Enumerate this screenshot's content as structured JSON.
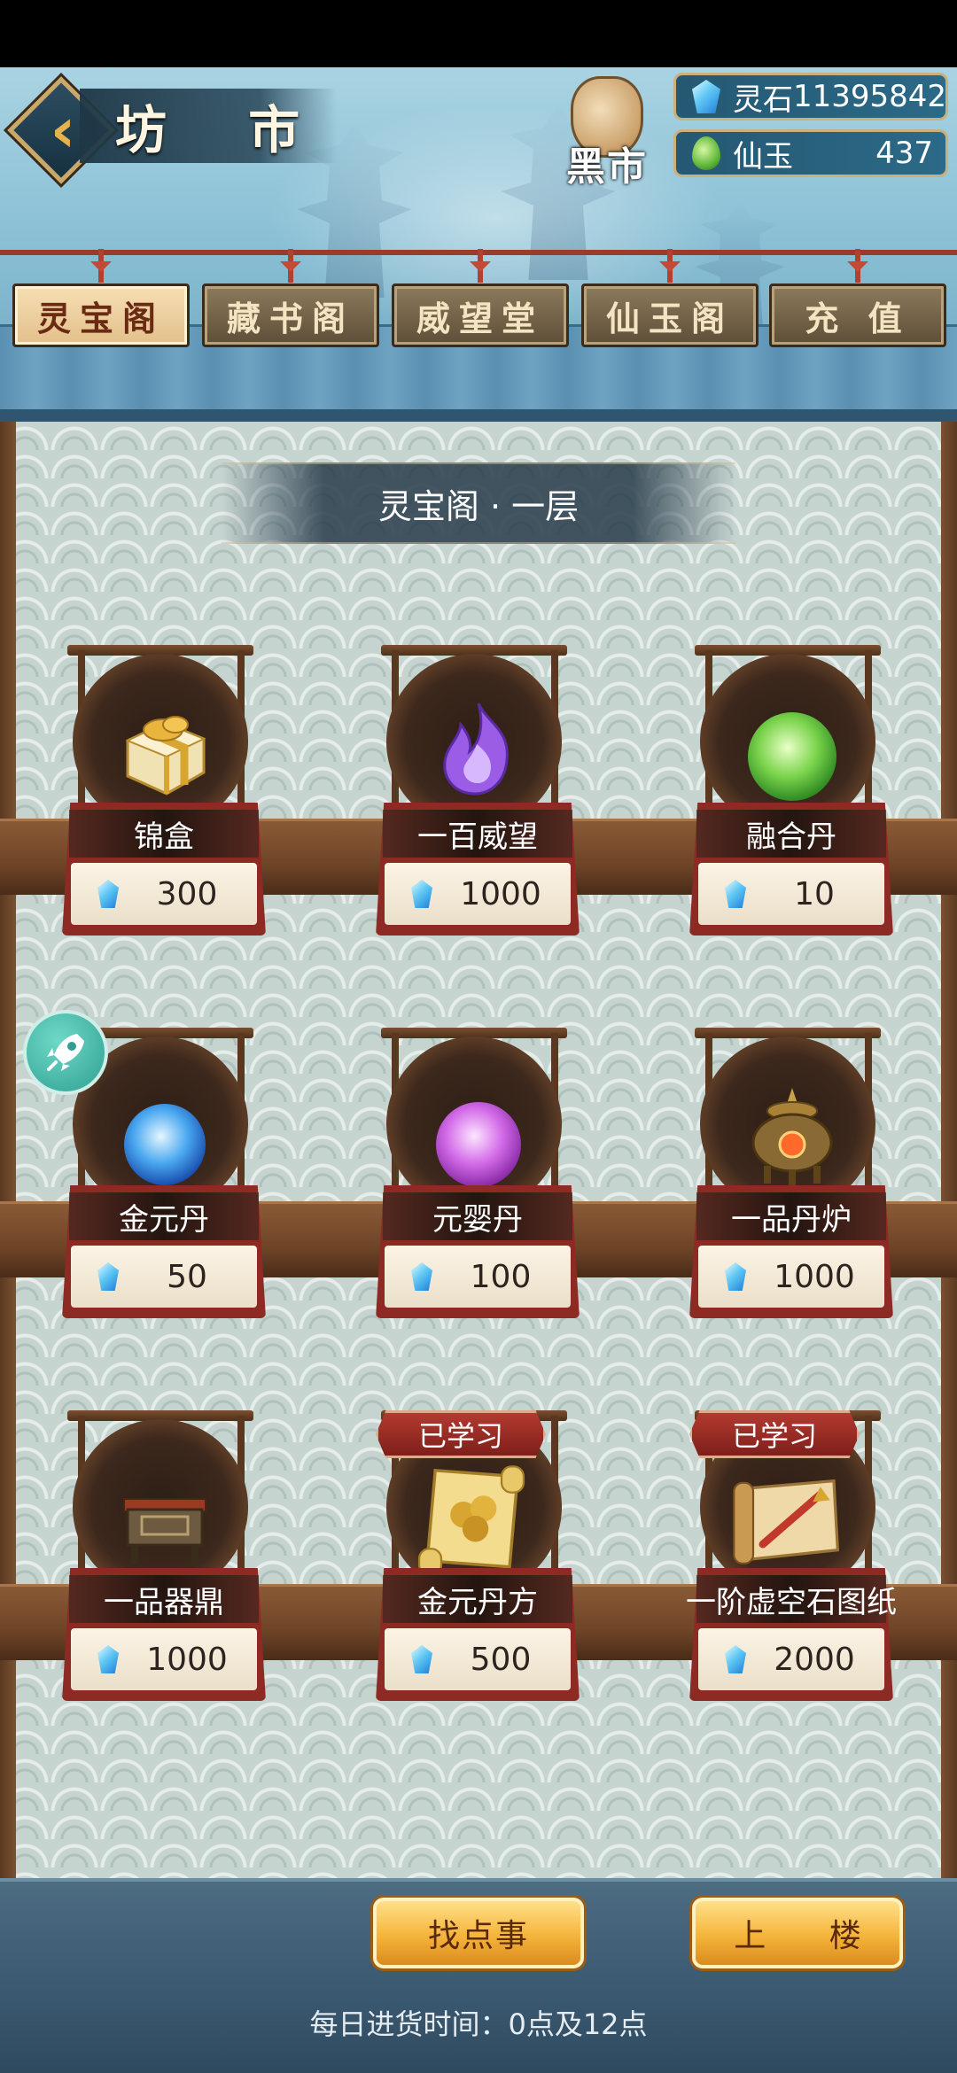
{
  "header": {
    "title": "坊 市",
    "black_market": "黑市",
    "currencies": [
      {
        "label": "灵石",
        "value": "11395842",
        "icon": "spirit-stone-gem-icon"
      },
      {
        "label": "仙玉",
        "value": "437",
        "icon": "immortal-jade-icon"
      }
    ],
    "tabs": [
      {
        "label": "灵宝阁",
        "active": true
      },
      {
        "label": "藏书阁",
        "active": false
      },
      {
        "label": "威望堂",
        "active": false
      },
      {
        "label": "仙玉阁",
        "active": false
      },
      {
        "label": "充 值",
        "active": false
      }
    ]
  },
  "shop": {
    "floor_title": "灵宝阁 · 一层",
    "price_icon": "spirit-stone-gem-icon",
    "items": [
      {
        "name": "锦盒",
        "price": "300",
        "icon": "gift-box-icon"
      },
      {
        "name": "一百威望",
        "price": "1000",
        "icon": "purple-flame-icon"
      },
      {
        "name": "融合丹",
        "price": "10",
        "icon": "green-orb-icon"
      },
      {
        "name": "金元丹",
        "price": "50",
        "icon": "blue-orb-icon"
      },
      {
        "name": "元婴丹",
        "price": "100",
        "icon": "violet-orb-icon"
      },
      {
        "name": "一品丹炉",
        "price": "1000",
        "icon": "alchemy-furnace-icon"
      },
      {
        "name": "一品器鼎",
        "price": "1000",
        "icon": "bronze-cauldron-icon"
      },
      {
        "name": "金元丹方",
        "price": "500",
        "icon": "recipe-scroll-icon",
        "badge": "已学习"
      },
      {
        "name": "一阶虚空石图纸",
        "price": "2000",
        "icon": "blueprint-scroll-icon",
        "badge": "已学习"
      }
    ]
  },
  "footer": {
    "find_button": "找点事",
    "upstairs_button": "上 楼",
    "restock_text": "每日进货时间：0点及12点"
  },
  "colors": {
    "accent_gold": "#f5b43a",
    "card_red": "#8e2a24",
    "header_blue": "#8cc1d6"
  }
}
